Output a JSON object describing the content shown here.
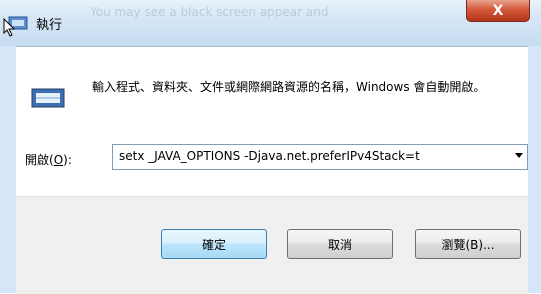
{
  "window": {
    "title": "執行",
    "close_label": "X",
    "background_text": "You may see a black screen appear and"
  },
  "dialog": {
    "description": "輸入程式、資料夾、文件或網際網路資源的名稱，Windows 會自動開啟。",
    "open_label_prefix": "開啟(",
    "open_label_key": "O",
    "open_label_suffix": "):",
    "command_value": "setx _JAVA_OPTIONS -Djava.net.preferIPv4Stack=t"
  },
  "buttons": {
    "ok": "確定",
    "cancel": "取消",
    "browse": "瀏覽(B)..."
  },
  "icons": {
    "title": "run-icon",
    "main": "run-dialog-icon",
    "dropdown": "chevron-down-icon"
  },
  "colors": {
    "close": "#c9462a",
    "default_button_border": "#3c7fb1"
  }
}
